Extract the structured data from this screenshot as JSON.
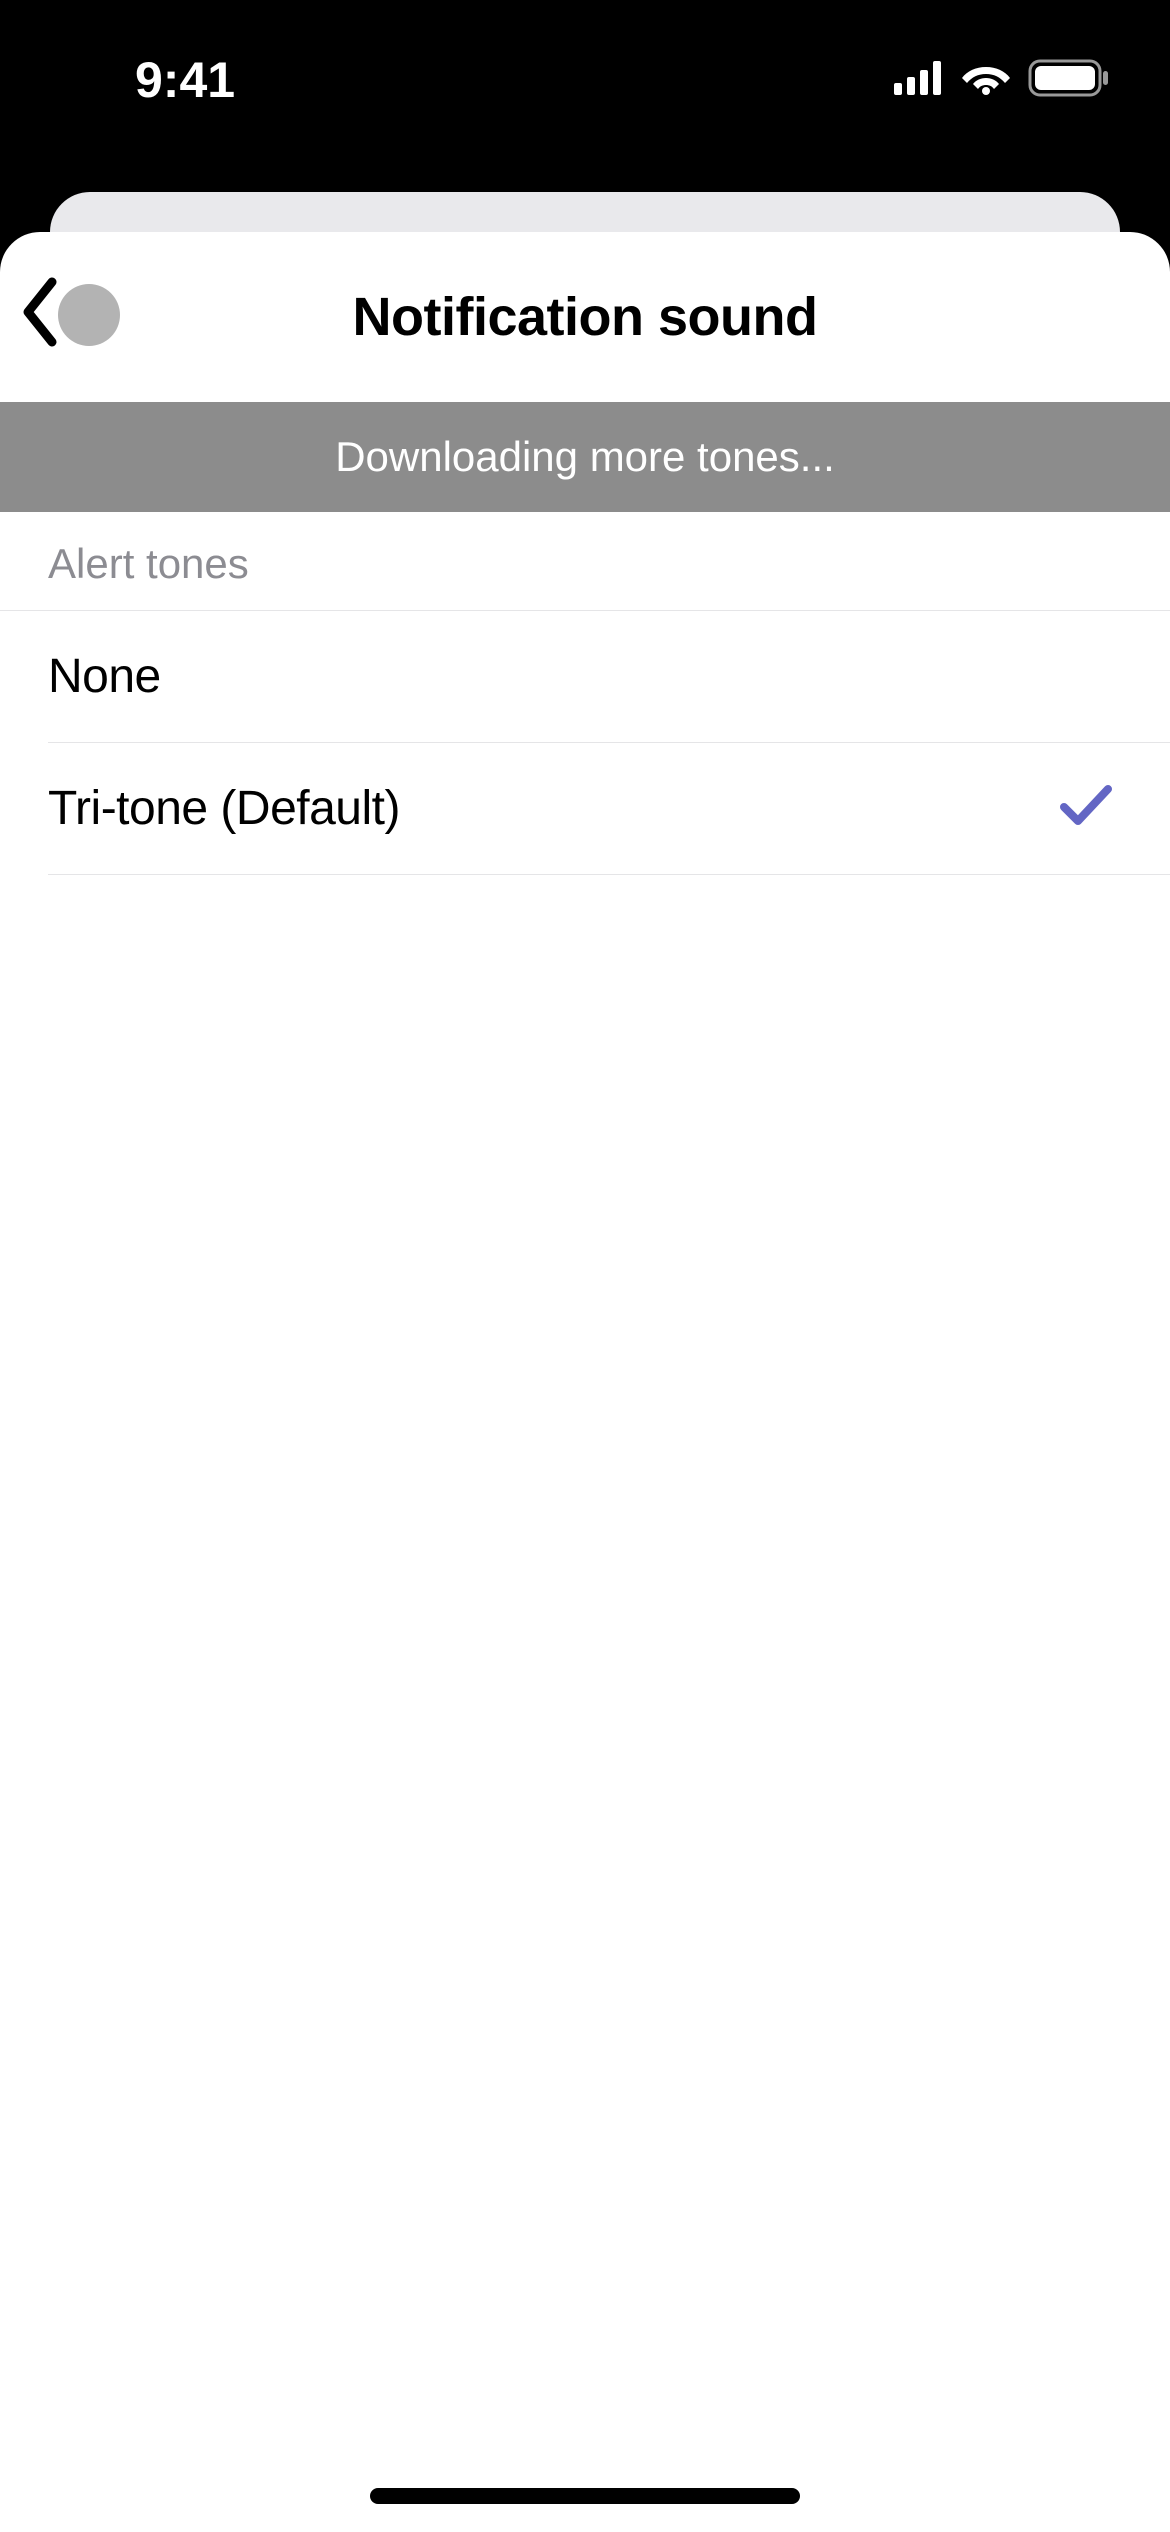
{
  "statusBar": {
    "time": "9:41"
  },
  "header": {
    "title": "Notification sound"
  },
  "banner": {
    "text": "Downloading more tones..."
  },
  "section": {
    "header": "Alert tones",
    "items": [
      {
        "label": "None",
        "selected": false
      },
      {
        "label": "Tri-tone (Default)",
        "selected": true
      }
    ]
  }
}
